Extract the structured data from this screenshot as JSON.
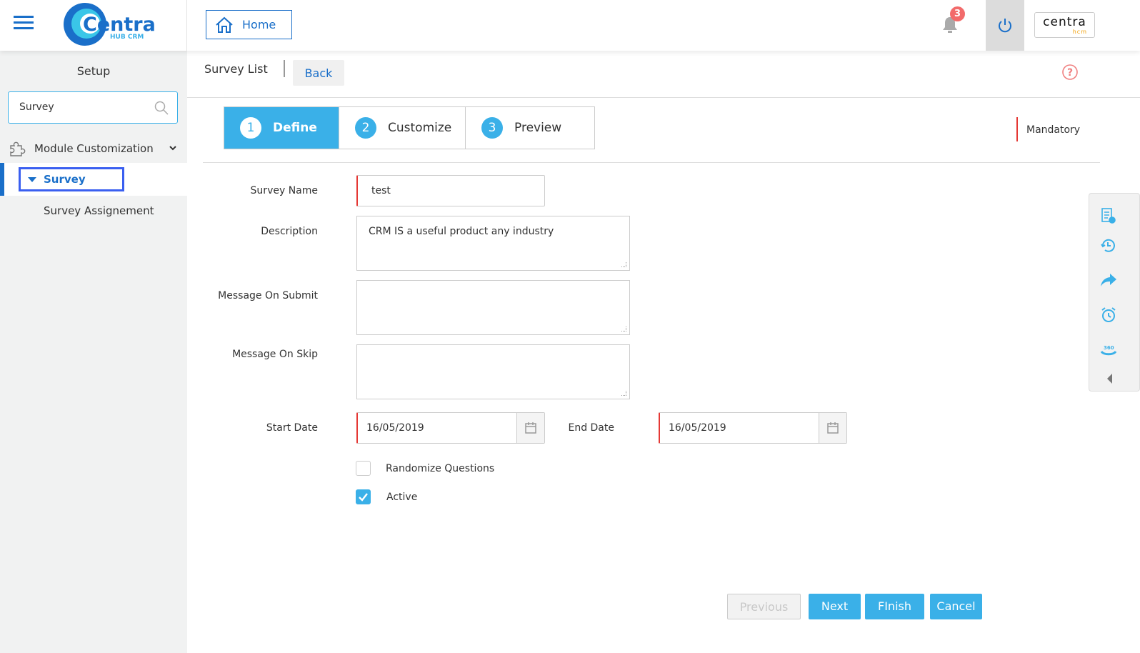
{
  "header": {
    "logo_text": "Centra",
    "logo_sub": "HUB CRM",
    "home_label": "Home",
    "notification_count": "3",
    "brand_text": "centra",
    "brand_sub": "hcm"
  },
  "sidebar": {
    "title": "Setup",
    "search_value": "Survey",
    "module_label": "Module Customization",
    "items": [
      {
        "label": "Survey"
      },
      {
        "label": "Survey Assignement"
      }
    ]
  },
  "subheader": {
    "title": "Survey List",
    "back_label": "Back"
  },
  "steps": [
    {
      "num": "1",
      "label": "Define"
    },
    {
      "num": "2",
      "label": "Customize"
    },
    {
      "num": "3",
      "label": "Preview"
    }
  ],
  "mandatory_label": "Mandatory",
  "form": {
    "survey_name_label": "Survey Name",
    "survey_name": "test",
    "description_label": "Description",
    "description": "CRM IS a useful product any industry",
    "msg_submit_label": "Message On Submit",
    "msg_submit": "",
    "msg_skip_label": "Message On Skip",
    "msg_skip": "",
    "start_date_label": "Start Date",
    "start_date": "16/05/2019",
    "end_date_label": "End Date",
    "end_date": "16/05/2019",
    "randomize_label": "Randomize Questions",
    "randomize": false,
    "active_label": "Active",
    "active": true
  },
  "buttons": {
    "previous": "Previous",
    "next": "Next",
    "finish": "FInish",
    "cancel": "Cancel"
  },
  "colors": {
    "accent": "#3ab0e8",
    "primary": "#1a6fc9",
    "required": "#e53935"
  }
}
